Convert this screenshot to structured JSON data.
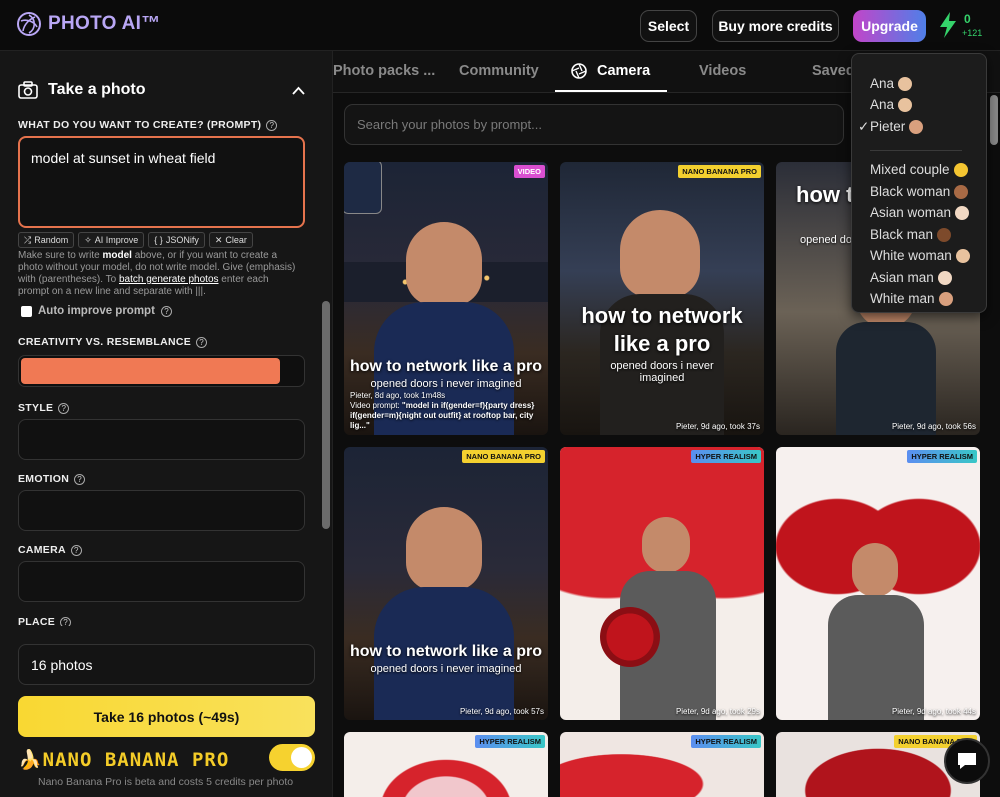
{
  "header": {
    "logo_text": "PHOTO AI™",
    "select_label": "Select",
    "buy_credits_label": "Buy more credits",
    "upgrade_label": "Upgrade",
    "credits_value": "0",
    "credits_delta": "+121"
  },
  "sidebar": {
    "title": "Take a photo",
    "prompt_label": "WHAT DO YOU WANT TO CREATE? (PROMPT)",
    "prompt_value": "model at sunset in wheat field",
    "tools": [
      "Random",
      "AI Improve",
      "JSONify",
      "Clear"
    ],
    "help_1": "Make sure to write ",
    "help_bold": "model",
    "help_2": " above, or if you want to create a photo without your model, do not write model. Give (emphasis) with (parentheses). To ",
    "help_link": "batch generate photos",
    "help_3": " enter each prompt on a new line and separate with |||.",
    "auto_improve_label": "Auto improve prompt",
    "creativity_label": "CREATIVITY VS. RESEMBLANCE",
    "creativity_value": 0.91,
    "style_label": "STYLE",
    "emotion_label": "EMOTION",
    "camera_label": "CAMERA",
    "place_label": "PLACE",
    "photos_count": "16 photos",
    "take_button": "Take 16 photos (~49s)",
    "nano_logo": "NANO BANANA PRO",
    "nano_note": "Nano Banana Pro is beta and costs 5 credits per photo"
  },
  "tabs": [
    {
      "label": "Photo packs ..."
    },
    {
      "label": "Community"
    },
    {
      "label": "Camera"
    },
    {
      "label": "Videos"
    },
    {
      "label": "Saved"
    }
  ],
  "search": {
    "placeholder": "Search your photos by prompt..."
  },
  "cards": [
    {
      "badge": "VIDEO",
      "title": "how to network like a pro",
      "subtitle": "opened doors i never imagined",
      "meta": "Pieter, 8d ago, took 1m48s",
      "video_prompt_label": "Video prompt:",
      "video_prompt": "\"model in if(gender=f){party dress} if(gender=m){night out outfit} at rooftop bar, city lig...\""
    },
    {
      "badge": "NANO BANANA PRO",
      "title": "how to network like a pro",
      "subtitle": "opened doors i never imagined",
      "meta": "Pieter, 9d ago, took 37s"
    },
    {
      "badge": "",
      "title": "how to like",
      "subtitle": "opened doors",
      "meta": "Pieter, 9d ago, took 56s"
    },
    {
      "badge": "NANO BANANA PRO",
      "title": "how to network like a pro",
      "subtitle": "opened doors i never imagined",
      "meta": "Pieter, 9d ago, took 57s"
    },
    {
      "badge": "HYPER REALISM",
      "meta": "Pieter, 9d ago, took 29s"
    },
    {
      "badge": "HYPER REALISM",
      "meta": "Pieter, 9d ago, took 44s"
    },
    {
      "badge": "HYPER REALISM"
    },
    {
      "badge": "HYPER REALISM"
    },
    {
      "badge": "NANO BANANA PRO"
    }
  ],
  "model_dropdown": {
    "models": [
      "Ana",
      "Ana",
      "Pieter"
    ],
    "selected": "Pieter",
    "presets": [
      "Mixed couple",
      "Black woman",
      "Asian woman",
      "Black man",
      "White woman",
      "Asian man",
      "White man"
    ]
  },
  "colors": {
    "accent_orange": "#f07954",
    "take_button": "#f9d832",
    "credits_green": "#35d36b"
  }
}
